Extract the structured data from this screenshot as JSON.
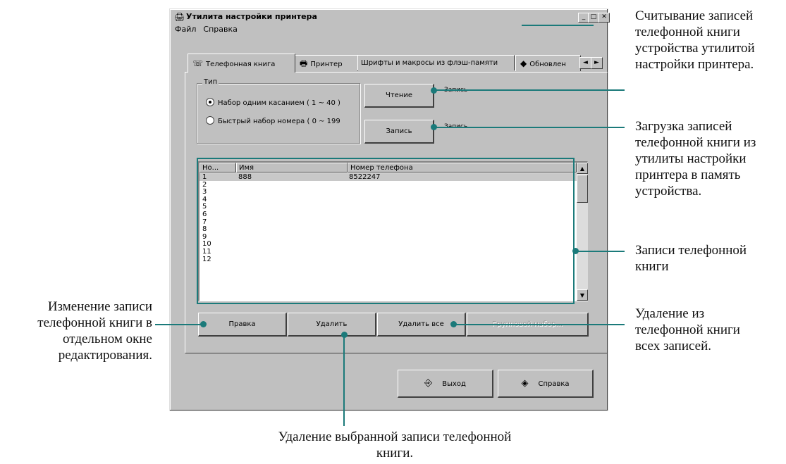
{
  "window": {
    "title": "Утилита настройки принтера",
    "menu": [
      "Файл",
      "Справка"
    ],
    "controls": [
      "_",
      "□",
      "✕"
    ]
  },
  "tabs": [
    {
      "label": "Телефонная книга",
      "icon": "phonebook-icon"
    },
    {
      "label": "Принтер",
      "icon": "printer-icon"
    },
    {
      "label": "Шрифты и макросы из флэш-памяти"
    },
    {
      "label": "Обновлен",
      "icon": "update-icon"
    }
  ],
  "tab_nav": {
    "left": "◄",
    "right": "►"
  },
  "type_group": {
    "label": "Тип",
    "options": [
      {
        "label": "Набор одним касанием ( 1 ~ 40 )",
        "selected": true
      },
      {
        "label": "Быстрый набор номера ( 0 ~ 199",
        "selected": false
      }
    ]
  },
  "buttons": {
    "read": "Чтение",
    "write": "Запись",
    "read_caption": "Запись",
    "write_caption": "Запись",
    "edit": "Правка",
    "delete": "Удалить",
    "delete_all": "Удалить все",
    "group": "Групповой набор...",
    "exit": "Выход",
    "help": "Справка"
  },
  "list": {
    "columns": [
      "Но...",
      "Имя",
      "Номер телефона"
    ],
    "rows": [
      {
        "no": "1",
        "name": "888",
        "phone": "8522247"
      },
      {
        "no": "2",
        "name": "",
        "phone": ""
      },
      {
        "no": "3",
        "name": "",
        "phone": ""
      },
      {
        "no": "4",
        "name": "",
        "phone": ""
      },
      {
        "no": "5",
        "name": "",
        "phone": ""
      },
      {
        "no": "6",
        "name": "",
        "phone": ""
      },
      {
        "no": "7",
        "name": "",
        "phone": ""
      },
      {
        "no": "8",
        "name": "",
        "phone": ""
      },
      {
        "no": "9",
        "name": "",
        "phone": ""
      },
      {
        "no": "10",
        "name": "",
        "phone": ""
      },
      {
        "no": "11",
        "name": "",
        "phone": ""
      },
      {
        "no": "12",
        "name": "",
        "phone": ""
      }
    ]
  },
  "annotations": {
    "read": "Считывание записей телефонной книги устройства утилитой настройки принтера.",
    "write": "Загрузка записей телефонной книги из утилиты настройки принтера в память устройства.",
    "records": "Записи телефонной книги",
    "delete_all": "Удаление из телефонной книги всех записей.",
    "edit": "Изменение записи телефонной книги в отдельном окне редактирования.",
    "delete": "Удаление выбранной записи телефонной книги."
  },
  "colors": {
    "callout": "#1b7a7a",
    "window": "#c0c0c0"
  }
}
